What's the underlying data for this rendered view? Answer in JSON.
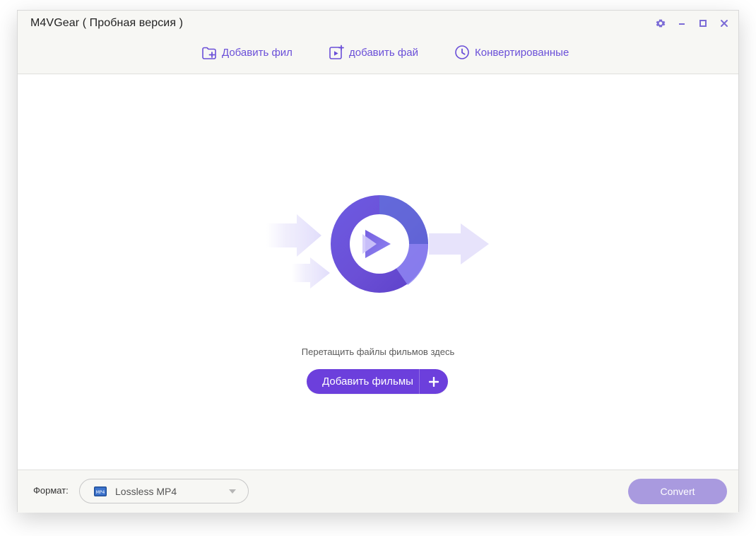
{
  "window": {
    "title": "M4VGear ( Пробная версия )"
  },
  "window_controls": {
    "settings_icon": "gear-icon",
    "minimize_icon": "minimize-icon",
    "maximize_icon": "maximize-icon",
    "close_icon": "close-icon"
  },
  "toolbar": {
    "items": [
      {
        "label": "Добавить фил",
        "icon": "add-folder-icon"
      },
      {
        "label": "добавить фай",
        "icon": "add-video-icon"
      },
      {
        "label": "Конвертированные",
        "icon": "clock-icon"
      }
    ]
  },
  "main": {
    "drop_hint": "Перетащить файлы фильмов здесь",
    "add_movies_button_label": "Добавить фильмы",
    "add_movies_plus": "+"
  },
  "bottom": {
    "format_label": "Формат:",
    "format_value": "Lossless MP4",
    "format_icon_text": "MP4",
    "convert_label": "Convert"
  },
  "colors": {
    "accent": "#6C3FDC",
    "accent_light": "#A99ADF",
    "toolbar_text": "#6A4FD8",
    "window_bg": "#F7F7F4"
  }
}
